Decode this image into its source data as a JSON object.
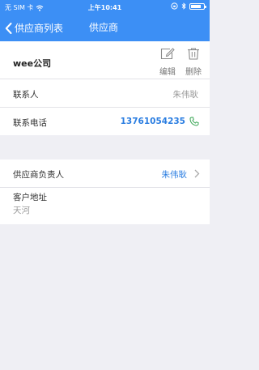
{
  "status_bar": {
    "carrier": "无 SIM 卡",
    "time": "上午10:41"
  },
  "nav": {
    "back_label": "供应商列表",
    "title": "供应商"
  },
  "header": {
    "company_name": "wee公司",
    "edit_label": "编辑",
    "delete_label": "删除"
  },
  "contact": {
    "person_label": "联系人",
    "person_value": "朱伟耿",
    "phone_label": "联系电话",
    "phone_value": "13761054235"
  },
  "detail": {
    "owner_label": "供应商负责人",
    "owner_value": "朱伟耿",
    "address_label": "客户地址",
    "address_value": "天河"
  },
  "colors": {
    "primary": "#3c8ff5",
    "link": "#2a7de1",
    "phone_icon": "#3aa655",
    "background": "#efeff4"
  },
  "icons": [
    "wifi-icon",
    "lock-rotation-icon",
    "bluetooth-icon",
    "battery-icon",
    "back-chevron-icon",
    "edit-icon",
    "trash-icon",
    "phone-icon",
    "chevron-right-icon"
  ]
}
